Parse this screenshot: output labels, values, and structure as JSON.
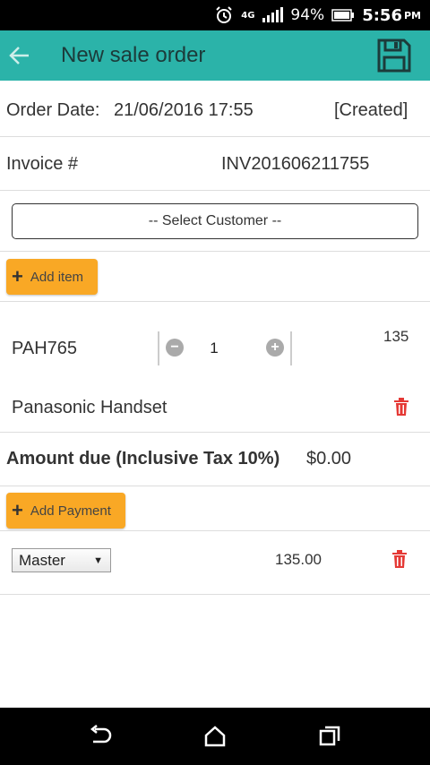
{
  "status_bar": {
    "network": "4G",
    "battery_pct": "94%",
    "time": "5:56",
    "ampm": "PM"
  },
  "app_bar": {
    "title": "New sale order"
  },
  "order": {
    "date_label": "Order Date:",
    "date_value": "21/06/2016 17:55",
    "status": "[Created]",
    "invoice_label": "Invoice #",
    "invoice_value": "INV201606211755"
  },
  "customer": {
    "select_label": "-- Select Customer --"
  },
  "buttons": {
    "add_item": "Add item",
    "add_payment": "Add Payment"
  },
  "items": [
    {
      "code": "PAH765",
      "quantity": "1",
      "price": "135",
      "name": "Panasonic Handset"
    }
  ],
  "amount_due": {
    "label": "Amount due (Inclusive Tax 10%)",
    "value": "$0.00"
  },
  "payments": [
    {
      "method": "Master",
      "amount": "135.00"
    }
  ],
  "colors": {
    "app_bar": "#2bb3a9",
    "button": "#f9a825",
    "delete": "#e53935"
  }
}
